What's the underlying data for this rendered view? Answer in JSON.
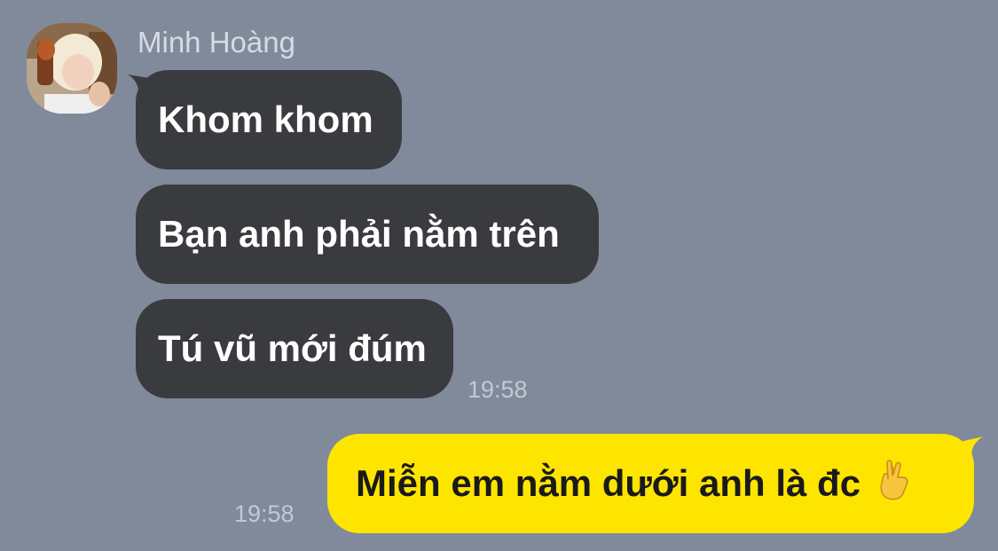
{
  "chat": {
    "sender": {
      "name": "Minh Hoàng",
      "avatar_icon": "profile-photo"
    },
    "incoming_messages": [
      {
        "text": "Khom khom"
      },
      {
        "text": "Bạn anh phải nằm trên"
      },
      {
        "text": "Tú vũ mới đúm"
      }
    ],
    "incoming_time": "19:58",
    "outgoing_message": {
      "text": "Miễn em nằm dưới anh là đc",
      "emoji_icon": "crossed-fingers-icon"
    },
    "outgoing_time": "19:58"
  },
  "colors": {
    "background": "#808a9b",
    "incoming_bubble": "#3a3b3f",
    "outgoing_bubble": "#fee500"
  }
}
